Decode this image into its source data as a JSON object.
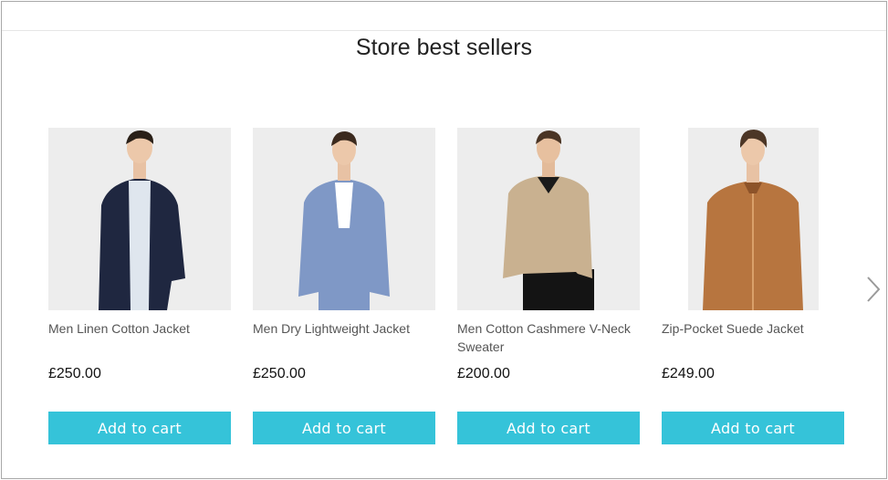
{
  "section": {
    "title": "Store best sellers",
    "add_to_cart_label": "Add to cart"
  },
  "products": [
    {
      "name": "Men Linen Cotton Jacket",
      "price": "£250.00",
      "jacket_color": "#1f2740",
      "shirt_color": "#dfe6ee",
      "pants_color": "#f2f2f2"
    },
    {
      "name": "Men Dry Lightweight Jacket",
      "price": "£250.00",
      "jacket_color": "#7f98c6",
      "shirt_color": "#ffffff",
      "pants_color": "#7f98c6"
    },
    {
      "name": "Men Cotton Cashmere V-Neck Sweater",
      "price": "£200.00",
      "jacket_color": "#c9b190",
      "shirt_color": "#1a1a1a",
      "pants_color": "#141414"
    },
    {
      "name": "Zip-Pocket Suede Jacket",
      "price": "£249.00",
      "jacket_color": "#b7753f",
      "shirt_color": "#8d5329",
      "pants_color": "#2a2a2a"
    }
  ],
  "colors": {
    "button_bg": "#35c3d9",
    "image_bg": "#ededed"
  },
  "icons": {
    "next": "chevron-right-icon"
  }
}
